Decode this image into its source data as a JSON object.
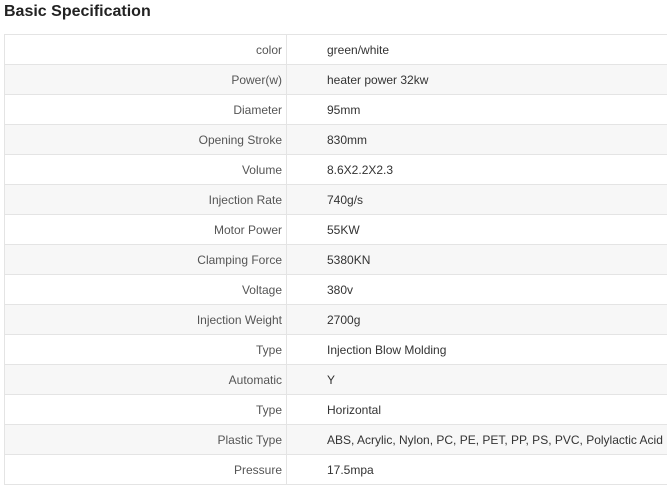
{
  "title": "Basic Specification",
  "rows": [
    {
      "label": "color",
      "value": "green/white"
    },
    {
      "label": "Power(w)",
      "value": "heater power 32kw"
    },
    {
      "label": "Diameter",
      "value": "95mm"
    },
    {
      "label": "Opening Stroke",
      "value": "830mm"
    },
    {
      "label": "Volume",
      "value": "8.6X2.2X2.3"
    },
    {
      "label": "Injection Rate",
      "value": "740g/s"
    },
    {
      "label": "Motor Power",
      "value": "55KW"
    },
    {
      "label": "Clamping Force",
      "value": "5380KN"
    },
    {
      "label": "Voltage",
      "value": "380v"
    },
    {
      "label": "Injection Weight",
      "value": "2700g"
    },
    {
      "label": "Type",
      "value": "Injection Blow Molding"
    },
    {
      "label": "Automatic",
      "value": "Y"
    },
    {
      "label": "Type",
      "value": "Horizontal"
    },
    {
      "label": "Plastic Type",
      "value": "ABS, Acrylic, Nylon, PC, PE, PET, PP, PS, PVC, Polylactic Acid"
    },
    {
      "label": "Pressure",
      "value": "17.5mpa"
    }
  ]
}
